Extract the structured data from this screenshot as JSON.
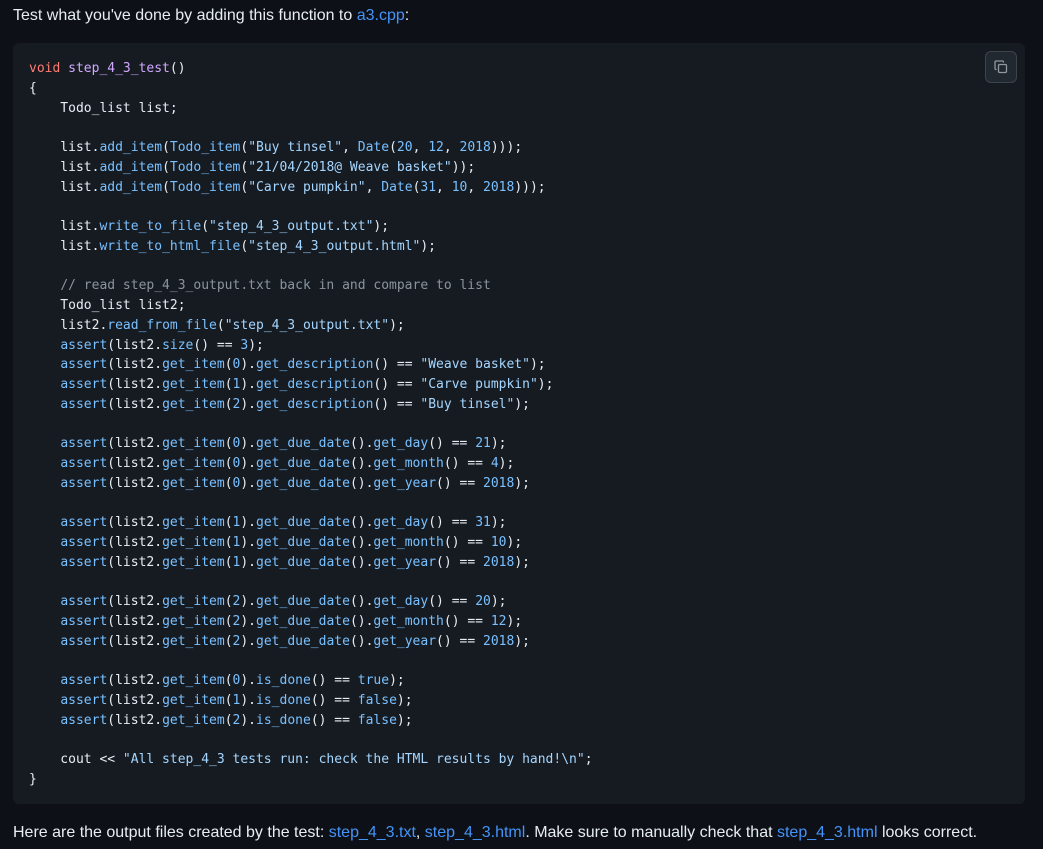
{
  "intro": {
    "text_before": "Test what you've done by adding this function to ",
    "link": "a3.cpp",
    "text_after": ":"
  },
  "code": {
    "copy_icon": "copy-icon",
    "lines": [
      "void step_4_3_test()",
      "{",
      "    Todo_list list;",
      "",
      "    list.add_item(Todo_item(\"Buy tinsel\", Date(20, 12, 2018)));",
      "    list.add_item(Todo_item(\"21/04/2018@ Weave basket\"));",
      "    list.add_item(Todo_item(\"Carve pumpkin\", Date(31, 10, 2018)));",
      "",
      "    list.write_to_file(\"step_4_3_output.txt\");",
      "    list.write_to_html_file(\"step_4_3_output.html\");",
      "",
      "    // read step_4_3_output.txt back in and compare to list",
      "    Todo_list list2;",
      "    list2.read_from_file(\"step_4_3_output.txt\");",
      "    assert(list2.size() == 3);",
      "    assert(list2.get_item(0).get_description() == \"Weave basket\");",
      "    assert(list2.get_item(1).get_description() == \"Carve pumpkin\");",
      "    assert(list2.get_item(2).get_description() == \"Buy tinsel\");",
      "",
      "    assert(list2.get_item(0).get_due_date().get_day() == 21);",
      "    assert(list2.get_item(0).get_due_date().get_month() == 4);",
      "    assert(list2.get_item(0).get_due_date().get_year() == 2018);",
      "",
      "    assert(list2.get_item(1).get_due_date().get_day() == 31);",
      "    assert(list2.get_item(1).get_due_date().get_month() == 10);",
      "    assert(list2.get_item(1).get_due_date().get_year() == 2018);",
      "",
      "    assert(list2.get_item(2).get_due_date().get_day() == 20);",
      "    assert(list2.get_item(2).get_due_date().get_month() == 12);",
      "    assert(list2.get_item(2).get_due_date().get_year() == 2018);",
      "",
      "    assert(list2.get_item(0).is_done() == true);",
      "    assert(list2.get_item(1).is_done() == false);",
      "    assert(list2.get_item(2).is_done() == false);",
      "",
      "    cout << \"All step_4_3 tests run: check the HTML results by hand!\\n\";",
      "}"
    ]
  },
  "outro": {
    "text_before": "Here are the output files created by the test: ",
    "link1": "step_4_3.txt",
    "sep": ", ",
    "link2": "step_4_3.html",
    "text_middle": ". Make sure to manually check that ",
    "link3": "step_4_3.html",
    "text_after": " looks correct."
  },
  "colors": {
    "background": "#0d1117",
    "code_background": "#161b22",
    "link": "#4493f8",
    "keyword": "#ff7b72",
    "function_name": "#d2a8ff",
    "call": "#79c0ff",
    "string": "#a5d6ff",
    "comment": "#8b949e"
  }
}
